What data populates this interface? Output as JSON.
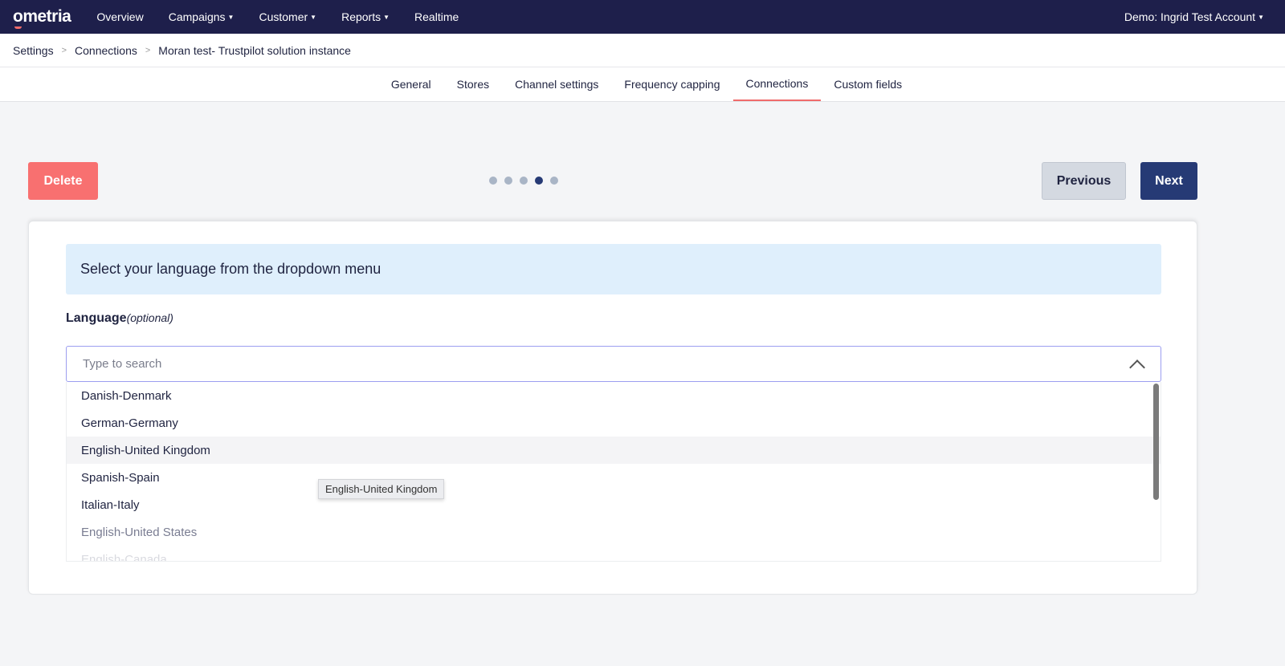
{
  "topbar": {
    "logo": "ometria",
    "nav": [
      "Overview",
      "Campaigns",
      "Customer",
      "Reports",
      "Realtime"
    ],
    "account": "Demo: Ingrid Test Account"
  },
  "breadcrumb": [
    "Settings",
    "Connections",
    "Moran test- Trustpilot solution instance"
  ],
  "tabs": [
    "General",
    "Stores",
    "Channel settings",
    "Frequency capping",
    "Connections",
    "Custom fields"
  ],
  "actions": {
    "delete": "Delete",
    "previous": "Previous",
    "next": "Next"
  },
  "stepper": {
    "total": 5,
    "current": 4
  },
  "form": {
    "info": "Select your language from the dropdown menu",
    "label": "Language",
    "optional": "(optional)",
    "placeholder": "Type to search",
    "options": [
      "Danish-Denmark",
      "German-Germany",
      "English-United Kingdom",
      "Spanish-Spain",
      "Italian-Italy",
      "English-United States",
      "English-Canada"
    ]
  },
  "tooltip": "English-United Kingdom"
}
